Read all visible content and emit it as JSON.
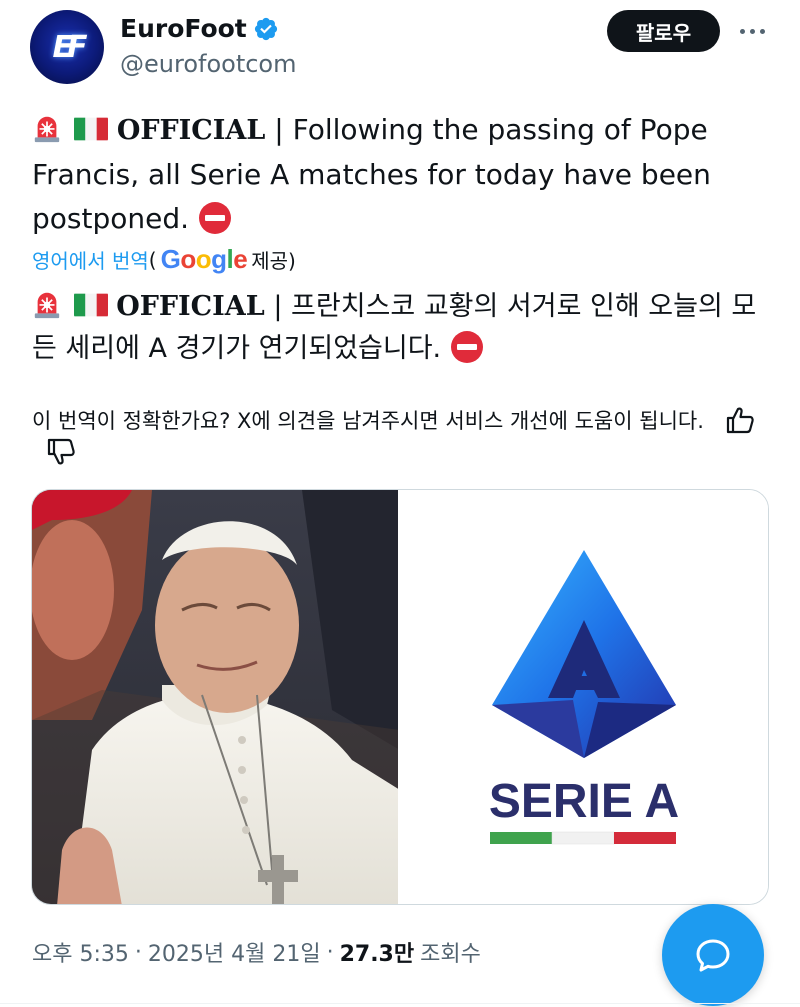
{
  "account": {
    "display_name": "EuroFoot",
    "handle": "@eurofootcom",
    "avatar_glyph": "EF",
    "verified_icon": "verified-badge-icon"
  },
  "actions": {
    "follow_label": "팔로우",
    "more_icon": "more-dots-icon"
  },
  "tweet": {
    "tag": "OFFICIAL",
    "separator": "|",
    "body": "Following the passing of Pope Francis, all Serie A matches for today have been postponed."
  },
  "translation": {
    "link": "영어에서 번역",
    "open_paren": "(",
    "provider": "Google",
    "provided_by": "제공)",
    "tag": "OFFICIAL",
    "separator": "|",
    "body": "프란치스코 교황의 서거로 인해 오늘의 모든 세리에 A 경기가 연기되었습니다."
  },
  "feedback": {
    "question": "이 번역이 정확한가요? X에 의견을 남겨주시면 서비스 개선에 도움이 됩니다."
  },
  "media": {
    "logo_text": "SERIE A",
    "colors": {
      "blue_top": "#2a9bff",
      "blue_dark": "#1f3bb3",
      "navy": "#2b2f6b",
      "green": "#3fa34d",
      "red": "#d42b3a"
    }
  },
  "meta": {
    "time": "오후 5:35",
    "dot1": "·",
    "date": "2025년 4월 21일",
    "dot2": "·",
    "views": "27.3만",
    "views_label": "조회수"
  },
  "fab_icon": "reply-bubble-icon",
  "colors": {
    "accent": "#1d9bf0",
    "text": "#0f1419",
    "muted": "#536471"
  }
}
